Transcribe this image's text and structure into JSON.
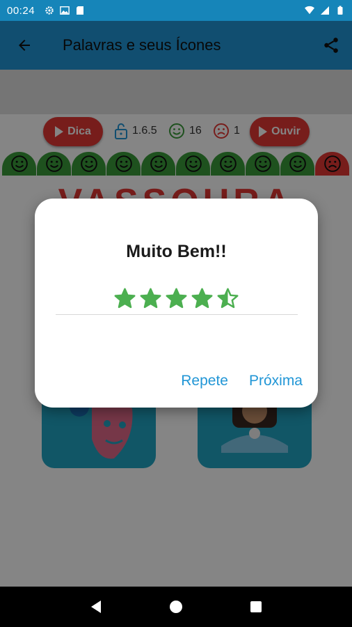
{
  "status_bar": {
    "time": "00:24"
  },
  "app_bar": {
    "title": "Palavras e seus Ícones"
  },
  "controls": {
    "hint_label": "Dica",
    "listen_label": "Ouvir",
    "level": "1.6.5",
    "correct_count": "16",
    "wrong_count": "1"
  },
  "faces": [
    "happy",
    "happy",
    "happy",
    "happy",
    "happy",
    "happy",
    "happy",
    "happy",
    "happy",
    "sad"
  ],
  "word": "VASSOURA",
  "dialog": {
    "title": "Muito Bem!!",
    "rating": 4.5,
    "rating_max": 5,
    "repeat_label": "Repete",
    "next_label": "Próxima"
  },
  "colors": {
    "primary": "#2196d6",
    "status_bar": "#1685b9",
    "accent_red": "#e53935",
    "success_green": "#3a9c3a",
    "star_green": "#4caf50"
  }
}
